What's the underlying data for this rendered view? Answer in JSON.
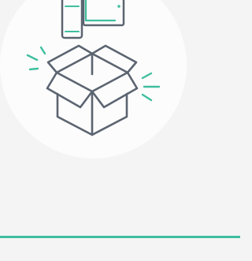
{
  "illustration": {
    "name": "unboxing-devices",
    "icons": [
      "phone-icon",
      "tablet-icon",
      "open-box-icon",
      "sparkle-icon"
    ]
  },
  "colors": {
    "background": "#f4f4f4",
    "circle": "#fcfcfc",
    "outline": "#5b6470",
    "accent": "#3fbf9f"
  }
}
